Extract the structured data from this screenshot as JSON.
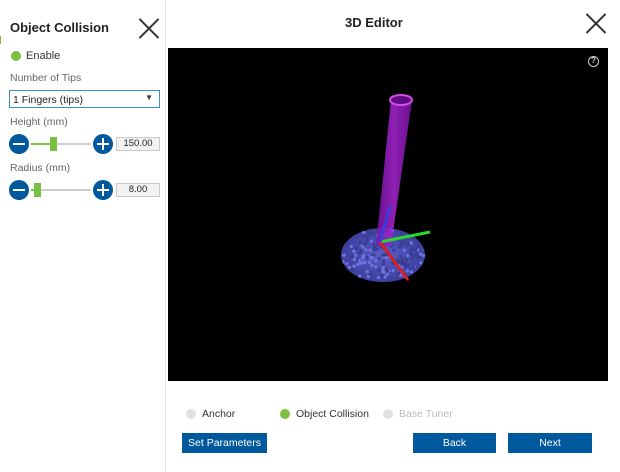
{
  "left_panel": {
    "title": "Object Collision",
    "enable_label": "Enable",
    "tips_label": "Number of  Tips",
    "tips_selected": "1 Fingers (tips)",
    "height_label": "Height (mm)",
    "height_value": "150.00",
    "height_level": 0.35,
    "radius_label": "Radius (mm)",
    "radius_value": "8.00",
    "radius_level": 0.06
  },
  "main": {
    "title": "3D Editor",
    "help_glyph": "?"
  },
  "steps": [
    {
      "label": "Anchor",
      "state": "inactive"
    },
    {
      "label": "Object Collision",
      "state": "active"
    },
    {
      "label": "Base Tuner",
      "state": "disabled"
    }
  ],
  "buttons": {
    "set_parameters": "Set Parameters",
    "back": "Back",
    "next": "Next"
  },
  "colors": {
    "accent_green": "#7ac143",
    "button_blue": "#00599c",
    "viewport_bg": "#000000",
    "cylinder": "#9b1fc6",
    "point_cloud": "#4b4fb8"
  }
}
